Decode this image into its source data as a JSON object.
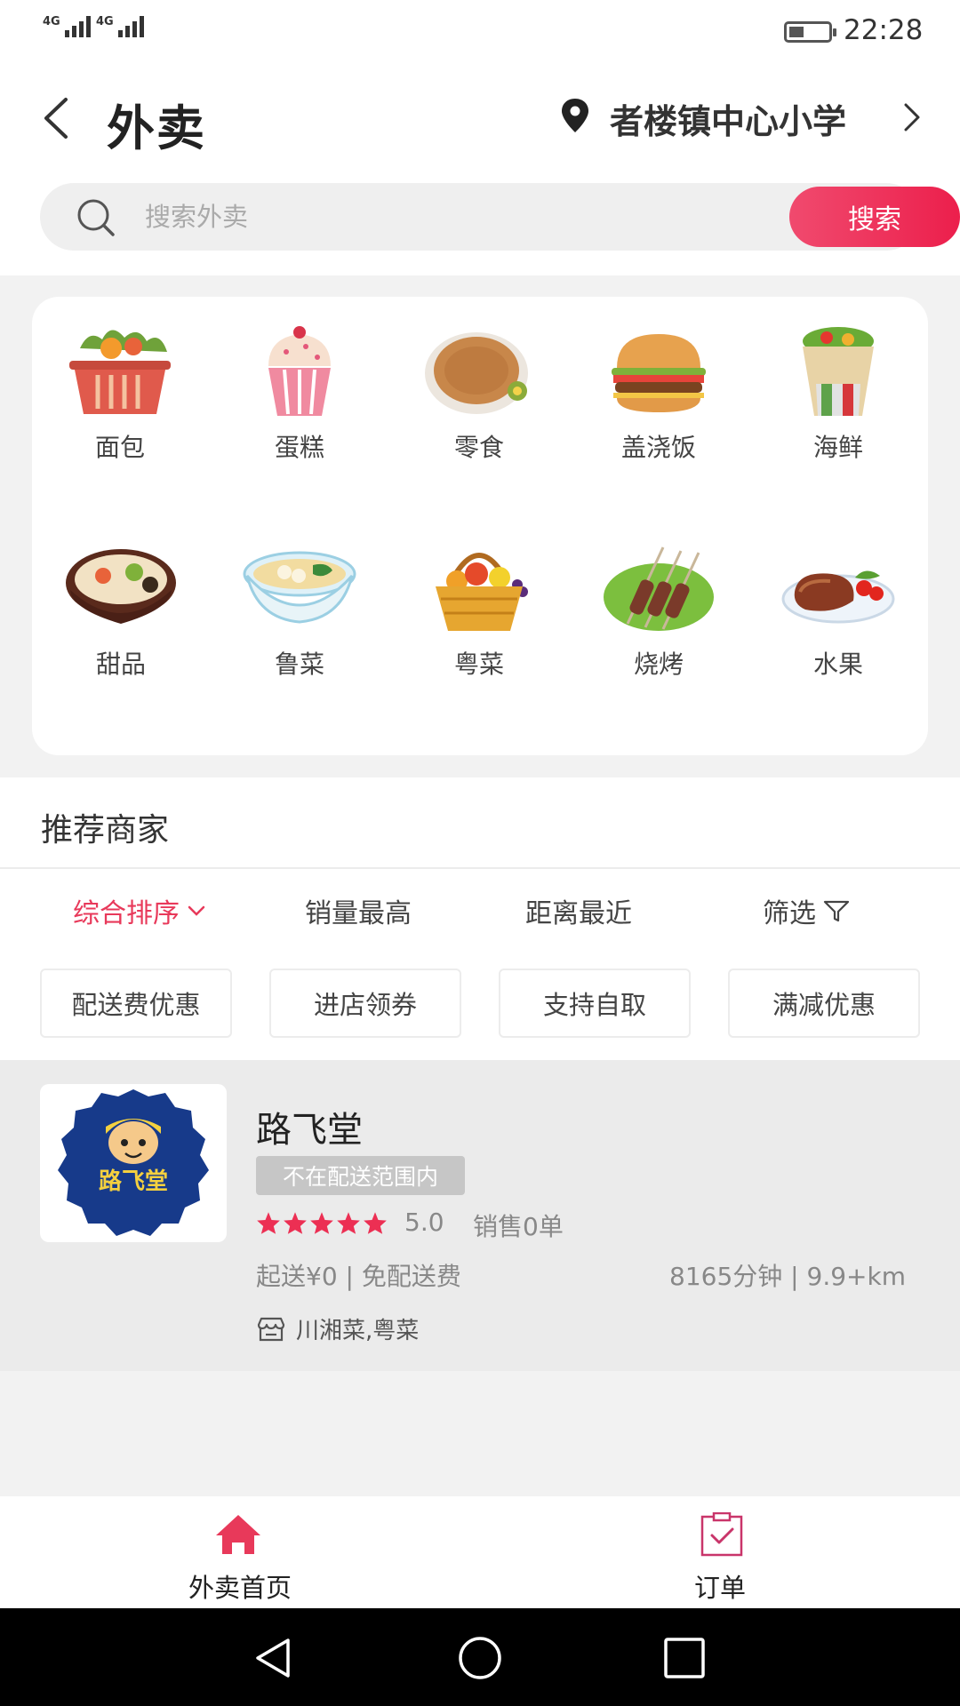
{
  "status_bar": {
    "signal1_label": "4G",
    "signal2_label": "4G",
    "time": "22:28"
  },
  "header": {
    "title": "外卖",
    "location": "者楼镇中心小学"
  },
  "search": {
    "placeholder": "搜索外卖",
    "button_label": "搜索"
  },
  "categories": [
    {
      "label": "面包",
      "icon": "basket-icon"
    },
    {
      "label": "蛋糕",
      "icon": "cupcake-icon"
    },
    {
      "label": "零食",
      "icon": "pancake-icon"
    },
    {
      "label": "盖浇饭",
      "icon": "burger-icon"
    },
    {
      "label": "海鲜",
      "icon": "wrap-icon"
    },
    {
      "label": "甜品",
      "icon": "hotpot-icon"
    },
    {
      "label": "鲁菜",
      "icon": "noodle-bowl-icon"
    },
    {
      "label": "粤菜",
      "icon": "fruit-basket-icon"
    },
    {
      "label": "烧烤",
      "icon": "skewers-icon"
    },
    {
      "label": "水果",
      "icon": "steak-icon"
    }
  ],
  "recommend": {
    "title": "推荐商家",
    "sort_options": [
      "综合排序",
      "销量最高",
      "距离最近",
      "筛选"
    ],
    "filters": [
      "配送费优惠",
      "进店领券",
      "支持自取",
      "满减优惠"
    ]
  },
  "store": {
    "name": "路飞堂",
    "logo_text": "路飞堂",
    "badge": "不在配送范围内",
    "rating": "5.0",
    "rating_value": 5,
    "sales": "销售0单",
    "delivery": "起送¥0 | 免配送费",
    "distance": "8165分钟 | 9.9+km",
    "cuisine": "川湘菜,粤菜"
  },
  "bottom_nav": {
    "home_label": "外卖首页",
    "orders_label": "订单"
  },
  "colors": {
    "accent": "#e8395a",
    "star": "#ec2f53"
  }
}
